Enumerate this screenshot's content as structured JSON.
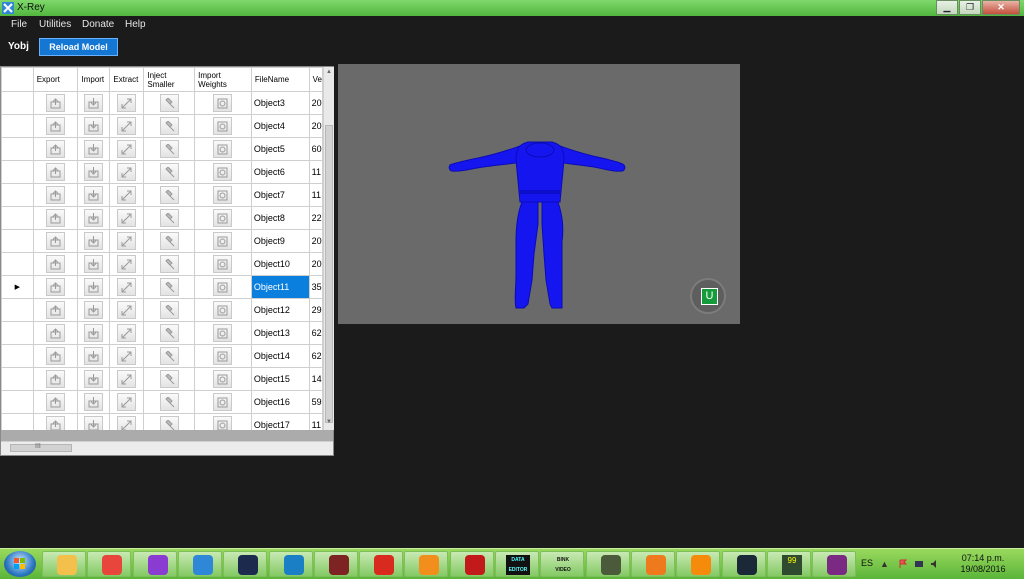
{
  "window": {
    "title": "X-Rey"
  },
  "window_controls": {
    "minimize": "▁",
    "maximize": "❐",
    "close": "✕"
  },
  "menu": {
    "file": "File",
    "utilities": "Utilities",
    "donate": "Donate",
    "help": "Help"
  },
  "toolbar": {
    "model_label": "Yobj",
    "reload_label": "Reload Model"
  },
  "grid": {
    "columns": [
      "Export",
      "Import",
      "Extract",
      "Inject Smaller",
      "Import Weights",
      "FileName",
      "Ve"
    ],
    "selected_row": "Object11",
    "rows": [
      {
        "name": "Object3",
        "v": "20"
      },
      {
        "name": "Object4",
        "v": "20"
      },
      {
        "name": "Object5",
        "v": "60"
      },
      {
        "name": "Object6",
        "v": "11"
      },
      {
        "name": "Object7",
        "v": "11"
      },
      {
        "name": "Object8",
        "v": "22"
      },
      {
        "name": "Object9",
        "v": "20"
      },
      {
        "name": "Object10",
        "v": "20"
      },
      {
        "name": "Object11",
        "v": "35"
      },
      {
        "name": "Object12",
        "v": "29"
      },
      {
        "name": "Object13",
        "v": "62"
      },
      {
        "name": "Object14",
        "v": "62"
      },
      {
        "name": "Object15",
        "v": "14"
      },
      {
        "name": "Object16",
        "v": "59"
      },
      {
        "name": "Object17",
        "v": "11"
      }
    ],
    "hscroll_glyph": "III"
  },
  "viewport": {
    "u_button": "U",
    "model_color": "#1212ee",
    "bg_color": "#6a6a6a"
  },
  "taskbar": {
    "icons": [
      "explorer-icon",
      "chrome-icon",
      "x-app-icon",
      "x-rey-icon",
      "photoshop-icon",
      "audio-app-icon",
      "shield-game-icon",
      "acrobat-icon",
      "blender-icon",
      "red-gear-icon",
      "data-editor-icon",
      "bink-video-icon",
      "3d-tool-icon",
      "orange-x-icon",
      "vlc-cone-icon",
      "steam-icon",
      "99-monitor-icon",
      "winrar-icon"
    ],
    "data_label": "DATA EDITOR",
    "bink_label": "BINK VIDEO",
    "nn_label": "99",
    "lang": "ES",
    "time": "07:14 p.m.",
    "date": "19/08/2016"
  }
}
